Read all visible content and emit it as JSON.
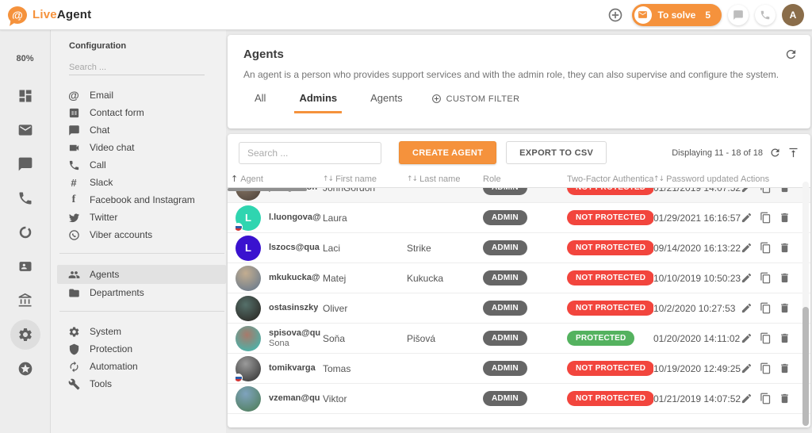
{
  "colors": {
    "accent": "#f5923c",
    "red": "#f2453d",
    "green": "#54b25f",
    "admin_gray": "#666666",
    "avatar_brown": "#8a6d4a"
  },
  "topbar": {
    "brand_live": "Live",
    "brand_agent": "Agent",
    "to_solve_label": "To solve",
    "to_solve_count": "5",
    "avatar_initial": "A",
    "icons": [
      "add-circle-icon",
      "envelope-icon",
      "chat-icon",
      "phone-icon"
    ]
  },
  "rail": {
    "percent": "80%",
    "icons": [
      {
        "name": "dashboard",
        "active": false
      },
      {
        "name": "mail",
        "active": false
      },
      {
        "name": "chat",
        "active": false
      },
      {
        "name": "call",
        "active": false
      },
      {
        "name": "ring",
        "active": false
      },
      {
        "name": "contacts",
        "active": false
      },
      {
        "name": "bank",
        "active": false
      },
      {
        "name": "settings",
        "active": true
      },
      {
        "name": "star",
        "active": false
      }
    ]
  },
  "config": {
    "title": "Configuration",
    "search_placeholder": "Search ...",
    "groups": [
      {
        "items": [
          {
            "label": "Email",
            "icon": "at"
          },
          {
            "label": "Contact form",
            "icon": "form"
          },
          {
            "label": "Chat",
            "icon": "chat"
          },
          {
            "label": "Video chat",
            "icon": "videocam"
          },
          {
            "label": "Call",
            "icon": "call"
          },
          {
            "label": "Slack",
            "icon": "slack"
          },
          {
            "label": "Facebook and Instagram",
            "icon": "facebook"
          },
          {
            "label": "Twitter",
            "icon": "twitter"
          },
          {
            "label": "Viber accounts",
            "icon": "viber"
          }
        ]
      },
      {
        "items": [
          {
            "label": "Agents",
            "icon": "people",
            "active": true
          },
          {
            "label": "Departments",
            "icon": "folder"
          }
        ]
      },
      {
        "items": [
          {
            "label": "System",
            "icon": "settings"
          },
          {
            "label": "Protection",
            "icon": "shield"
          },
          {
            "label": "Automation",
            "icon": "autorenew"
          },
          {
            "label": "Tools",
            "icon": "wrench"
          }
        ]
      }
    ]
  },
  "page": {
    "title": "Agents",
    "description": "An agent is a person who provides support services and with the admin role, they can also supervise and configure the system.",
    "tabs": [
      {
        "label": "All",
        "active": false
      },
      {
        "label": "Admins",
        "active": true
      },
      {
        "label": "Agents",
        "active": false
      },
      {
        "label": "CUSTOM FILTER",
        "active": false,
        "filter": true,
        "icon": "plus-circle"
      }
    ]
  },
  "toolbar": {
    "search_placeholder": "Search ...",
    "create_label": "CREATE AGENT",
    "export_label": "EXPORT TO CSV",
    "displaying": "Displaying 11 - 18 of 18"
  },
  "table": {
    "columns": [
      {
        "label": "Agent",
        "sort": "asc"
      },
      {
        "label": "First name",
        "sort": "both"
      },
      {
        "label": "Last name",
        "sort": "both"
      },
      {
        "label": "Role",
        "sort": "none"
      },
      {
        "label": "Two-Factor Authentication",
        "sort": "none"
      },
      {
        "label": "Password updated",
        "sort": "both"
      },
      {
        "label": "Actions",
        "sort": "none"
      }
    ],
    "rows": [
      {
        "partial": true,
        "email": "johngordon",
        "sub": "",
        "first": "JohnGordon",
        "last": "",
        "role": "ADMIN",
        "tfa": "NOT PROTECTED",
        "tfa_state": "red",
        "updated": "01/21/2019 14:07:52",
        "avatar": {
          "type": "photo",
          "bg": "radial-gradient(circle at 35% 30%, #8c7a68, #4a4038)",
          "letter": ""
        },
        "flag": false
      },
      {
        "partial": false,
        "email": "l.luongova@",
        "sub": "",
        "first": "Laura",
        "last": "",
        "role": "ADMIN",
        "tfa": "NOT PROTECTED",
        "tfa_state": "red",
        "updated": "01/29/2021 16:16:57",
        "avatar": {
          "type": "letter",
          "bg": "#2fd5b0",
          "letter": "L"
        },
        "flag": true
      },
      {
        "partial": false,
        "email": "lszocs@qua",
        "sub": "",
        "first": "Laci",
        "last": "Strike",
        "role": "ADMIN",
        "tfa": "NOT PROTECTED",
        "tfa_state": "red",
        "updated": "09/14/2020 16:13:22",
        "avatar": {
          "type": "letter",
          "bg": "#3a12cf",
          "letter": "L"
        },
        "flag": false
      },
      {
        "partial": false,
        "email": "mkukucka@",
        "sub": "",
        "first": "Matej",
        "last": "Kukucka",
        "role": "ADMIN",
        "tfa": "NOT PROTECTED",
        "tfa_state": "red",
        "updated": "10/10/2019 10:50:23",
        "avatar": {
          "type": "photo",
          "bg": "radial-gradient(circle at 40% 30%, #c3ad90, #5e748c)",
          "letter": ""
        },
        "flag": false
      },
      {
        "partial": false,
        "email": "ostasinszky",
        "sub": "",
        "first": "Oliver",
        "last": "",
        "role": "ADMIN",
        "tfa": "NOT PROTECTED",
        "tfa_state": "red",
        "updated": "10/2/2020 10:27:53",
        "avatar": {
          "type": "photo",
          "bg": "radial-gradient(circle at 40% 35%, #55706a, #26201c)",
          "letter": ""
        },
        "flag": false
      },
      {
        "partial": false,
        "email": "spisova@qu",
        "sub": "Sona",
        "first": "Soňa",
        "last": "Pišová",
        "role": "ADMIN",
        "tfa": "PROTECTED",
        "tfa_state": "green",
        "updated": "01/20/2020 14:11:02",
        "avatar": {
          "type": "photo",
          "bg": "radial-gradient(circle at 45% 35%, #a8796a, #35c0b8)",
          "letter": ""
        },
        "flag": false
      },
      {
        "partial": false,
        "email": "tomikvarga",
        "sub": "",
        "first": "Tomas",
        "last": "",
        "role": "ADMIN",
        "tfa": "NOT PROTECTED",
        "tfa_state": "red",
        "updated": "10/19/2020 12:49:25",
        "avatar": {
          "type": "photo",
          "bg": "radial-gradient(circle at 40% 30%, #9a9a9a, #2e2e2e)",
          "letter": ""
        },
        "flag": true
      },
      {
        "partial": false,
        "email": "vzeman@qu",
        "sub": "",
        "first": "Viktor",
        "last": "",
        "role": "ADMIN",
        "tfa": "NOT PROTECTED",
        "tfa_state": "red",
        "updated": "01/21/2019 14:07:52",
        "avatar": {
          "type": "photo",
          "bg": "radial-gradient(circle at 40% 30%, #7fa3be, #4a7a50)",
          "letter": ""
        },
        "flag": false
      }
    ]
  }
}
